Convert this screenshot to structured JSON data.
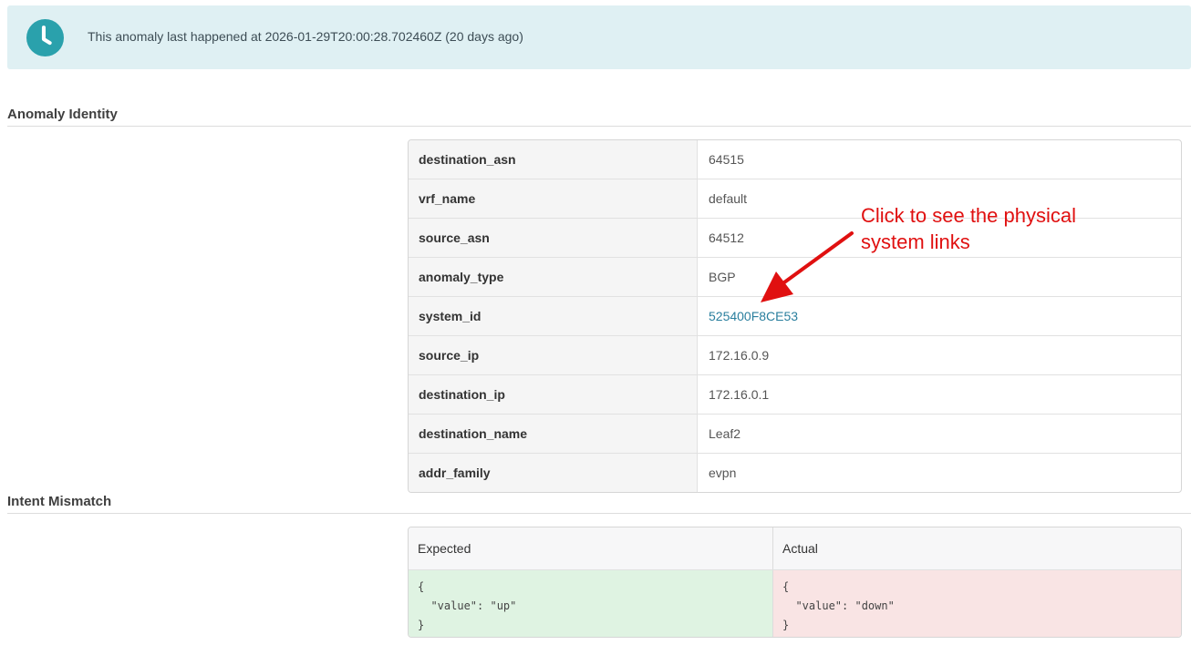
{
  "alert": {
    "text": "This anomaly last happened at 2026-01-29T20:00:28.702460Z (20 days ago)",
    "icon": "clock-icon",
    "icon_color": "#2aa1ac"
  },
  "identity": {
    "title": "Anomaly Identity",
    "rows": [
      {
        "key": "destination_asn",
        "value": "64515"
      },
      {
        "key": "vrf_name",
        "value": "default"
      },
      {
        "key": "source_asn",
        "value": "64512"
      },
      {
        "key": "anomaly_type",
        "value": "BGP"
      },
      {
        "key": "system_id",
        "value": "525400F8CE53"
      },
      {
        "key": "source_ip",
        "value": "172.16.0.9"
      },
      {
        "key": "destination_ip",
        "value": "172.16.0.1"
      },
      {
        "key": "destination_name",
        "value": "Leaf2"
      },
      {
        "key": "addr_family",
        "value": "evpn"
      }
    ]
  },
  "annotation": {
    "text": "Click to see the physical system links",
    "color": "#e01010"
  },
  "mismatch": {
    "title": "Intent Mismatch",
    "expected_label": "Expected",
    "actual_label": "Actual",
    "expected_value": "{\n  \"value\": \"up\"\n}",
    "actual_value": "{\n  \"value\": \"down\"\n}",
    "expected_bg": "#dff3e2",
    "actual_bg": "#f9e4e4"
  }
}
